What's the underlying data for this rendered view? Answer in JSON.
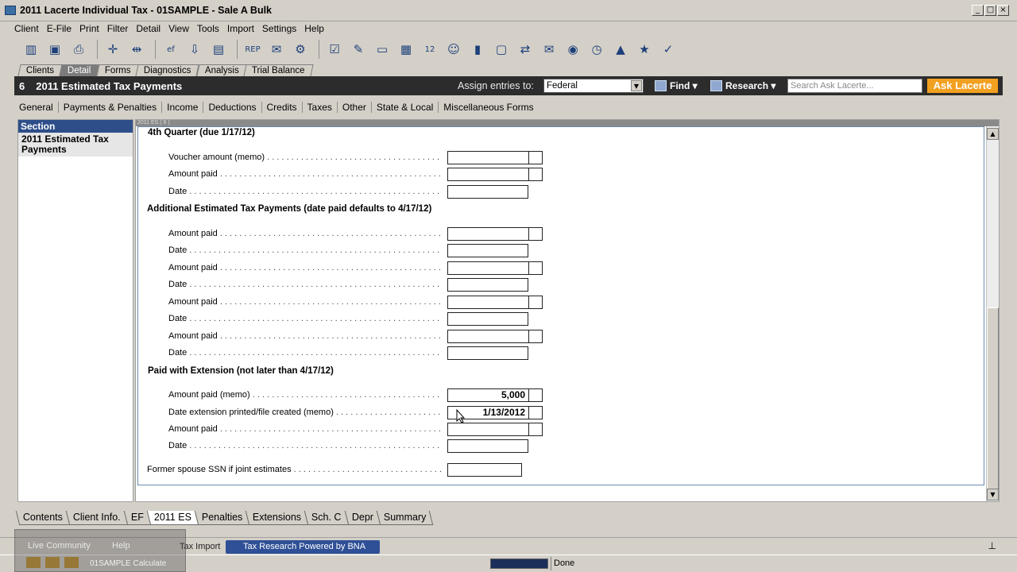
{
  "window": {
    "title": "2011 Lacerte Individual Tax - 01SAMPLE - Sale A Bulk"
  },
  "menu": [
    "Client",
    "E-File",
    "Print",
    "Filter",
    "Detail",
    "View",
    "Tools",
    "Import",
    "Settings",
    "Help"
  ],
  "toolbar_icons": [
    {
      "name": "client-list-icon",
      "glyph": "▥"
    },
    {
      "name": "save-icon",
      "glyph": "▣"
    },
    {
      "name": "print-icon",
      "glyph": "⎙"
    },
    {
      "name": "move-icon",
      "glyph": "✛"
    },
    {
      "name": "resize-icon",
      "glyph": "⇹"
    },
    {
      "name": "efile-icon",
      "glyph": "ef"
    },
    {
      "name": "download-icon",
      "glyph": "⇩"
    },
    {
      "name": "document-icon",
      "glyph": "▤"
    },
    {
      "name": "report-icon",
      "glyph": "REP"
    },
    {
      "name": "organizer-icon",
      "glyph": "✉"
    },
    {
      "name": "tools-icon",
      "glyph": "⚙"
    },
    {
      "name": "checklist-icon",
      "glyph": "☑"
    },
    {
      "name": "brush-icon",
      "glyph": "✎"
    },
    {
      "name": "note-icon",
      "glyph": "▭"
    },
    {
      "name": "calculator-icon",
      "glyph": "▦"
    },
    {
      "name": "number-icon",
      "glyph": "12"
    },
    {
      "name": "person-icon",
      "glyph": "☺"
    },
    {
      "name": "chart-icon",
      "glyph": "▮"
    },
    {
      "name": "folder-icon",
      "glyph": "▢"
    },
    {
      "name": "transfer-icon",
      "glyph": "⇄"
    },
    {
      "name": "mail-icon",
      "glyph": "✉"
    },
    {
      "name": "security-icon",
      "glyph": "◉"
    },
    {
      "name": "clock-icon",
      "glyph": "◷"
    },
    {
      "name": "alert-icon",
      "glyph": "▲"
    },
    {
      "name": "new-icon",
      "glyph": "★"
    },
    {
      "name": "check-icon",
      "glyph": "✓"
    }
  ],
  "top_tabs": [
    "Clients",
    "Detail",
    "Forms",
    "Diagnostics",
    "Analysis",
    "Trial Balance"
  ],
  "form_header": {
    "number": "6",
    "title": "2011 Estimated Tax Payments",
    "assign_label": "Assign entries to:",
    "assign_value": "Federal",
    "find_label": "Find",
    "research_label": "Research",
    "search_placeholder": "Search Ask Lacerte...",
    "ask_label": "Ask Lacerte"
  },
  "sub_tabs": [
    "General",
    "Payments & Penalties",
    "Income",
    "Deductions",
    "Credits",
    "Taxes",
    "Other",
    "State & Local",
    "Miscellaneous Forms"
  ],
  "section": {
    "header": "Section",
    "item": "2011 Estimated Tax Payments"
  },
  "form_strip": "2011 ES ( 6 )",
  "headings": {
    "q4": "4th Quarter (due 1/17/12)",
    "additional": "Additional Estimated Tax Payments  (date paid defaults to 4/17/12)",
    "extension": "Paid with Extension (not later than 4/17/12)"
  },
  "labels": {
    "voucher_memo": "Voucher amount (memo)",
    "amount_paid": "Amount paid",
    "date": "Date",
    "amount_paid_memo": "Amount paid (memo)",
    "ext_date_memo": "Date extension printed/file created (memo)",
    "former_ssn": "Former spouse SSN if joint estimates"
  },
  "values": {
    "ext_amount_paid_memo": "5,000",
    "ext_date_memo": "1/13/2012"
  },
  "bottom_tabs": [
    "Contents",
    "Client Info.",
    "EF",
    "2011 ES",
    "Penalties",
    "Extensions",
    "Sch. C",
    "Depr",
    "Summary"
  ],
  "lower_panel": {
    "live_community": "Live Community",
    "help": "Help",
    "tax_import": "Tax Import",
    "tax_research": "Tax Research Powered by BNA"
  },
  "status": {
    "done": "Done",
    "task": "01SAMPLE Calculate"
  }
}
